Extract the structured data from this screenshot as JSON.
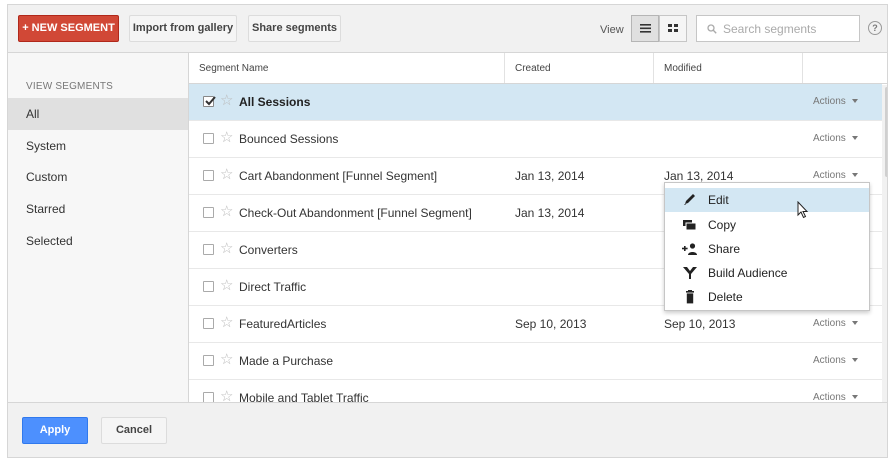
{
  "toolbar": {
    "new_segment": "+ NEW SEGMENT",
    "import": "Import from gallery",
    "share": "Share segments",
    "view_label": "View",
    "search_placeholder": "Search segments",
    "help": "?"
  },
  "sidebar": {
    "header": "VIEW SEGMENTS",
    "items": [
      {
        "label": "All"
      },
      {
        "label": "System"
      },
      {
        "label": "Custom"
      },
      {
        "label": "Starred"
      },
      {
        "label": "Selected"
      }
    ]
  },
  "table": {
    "columns": [
      "Segment Name",
      "Created",
      "Modified"
    ],
    "rows": [
      {
        "name": "All Sessions",
        "created": "",
        "modified": "",
        "actions": "Actions",
        "checked": true
      },
      {
        "name": "Bounced Sessions",
        "created": "",
        "modified": "",
        "actions": "Actions"
      },
      {
        "name": "Cart Abandonment [Funnel Segment]",
        "created": "Jan 13, 2014",
        "modified": "Jan 13, 2014",
        "actions": "Actions"
      },
      {
        "name": "Check-Out Abandonment [Funnel Segment]",
        "created": "Jan 13, 2014",
        "modified": "",
        "actions": ""
      },
      {
        "name": "Converters",
        "created": "",
        "modified": "",
        "actions": ""
      },
      {
        "name": "Direct Traffic",
        "created": "",
        "modified": "",
        "actions": ""
      },
      {
        "name": "FeaturedArticles",
        "created": "Sep 10, 2013",
        "modified": "Sep 10, 2013",
        "actions": "Actions"
      },
      {
        "name": "Made a Purchase",
        "created": "",
        "modified": "",
        "actions": "Actions"
      },
      {
        "name": "Mobile and Tablet Traffic",
        "created": "",
        "modified": "",
        "actions": "Actions"
      }
    ]
  },
  "menu": {
    "items": [
      {
        "label": "Edit",
        "icon": "pencil-icon"
      },
      {
        "label": "Copy",
        "icon": "copy-icon"
      },
      {
        "label": "Share",
        "icon": "share-person-icon"
      },
      {
        "label": "Build Audience",
        "icon": "audience-fork-icon"
      },
      {
        "label": "Delete",
        "icon": "trash-icon"
      }
    ]
  },
  "footer": {
    "apply": "Apply",
    "cancel": "Cancel"
  },
  "colors": {
    "new_segment": "#d14836",
    "apply": "#4d90fe",
    "selected_row": "#d3e7f3"
  }
}
